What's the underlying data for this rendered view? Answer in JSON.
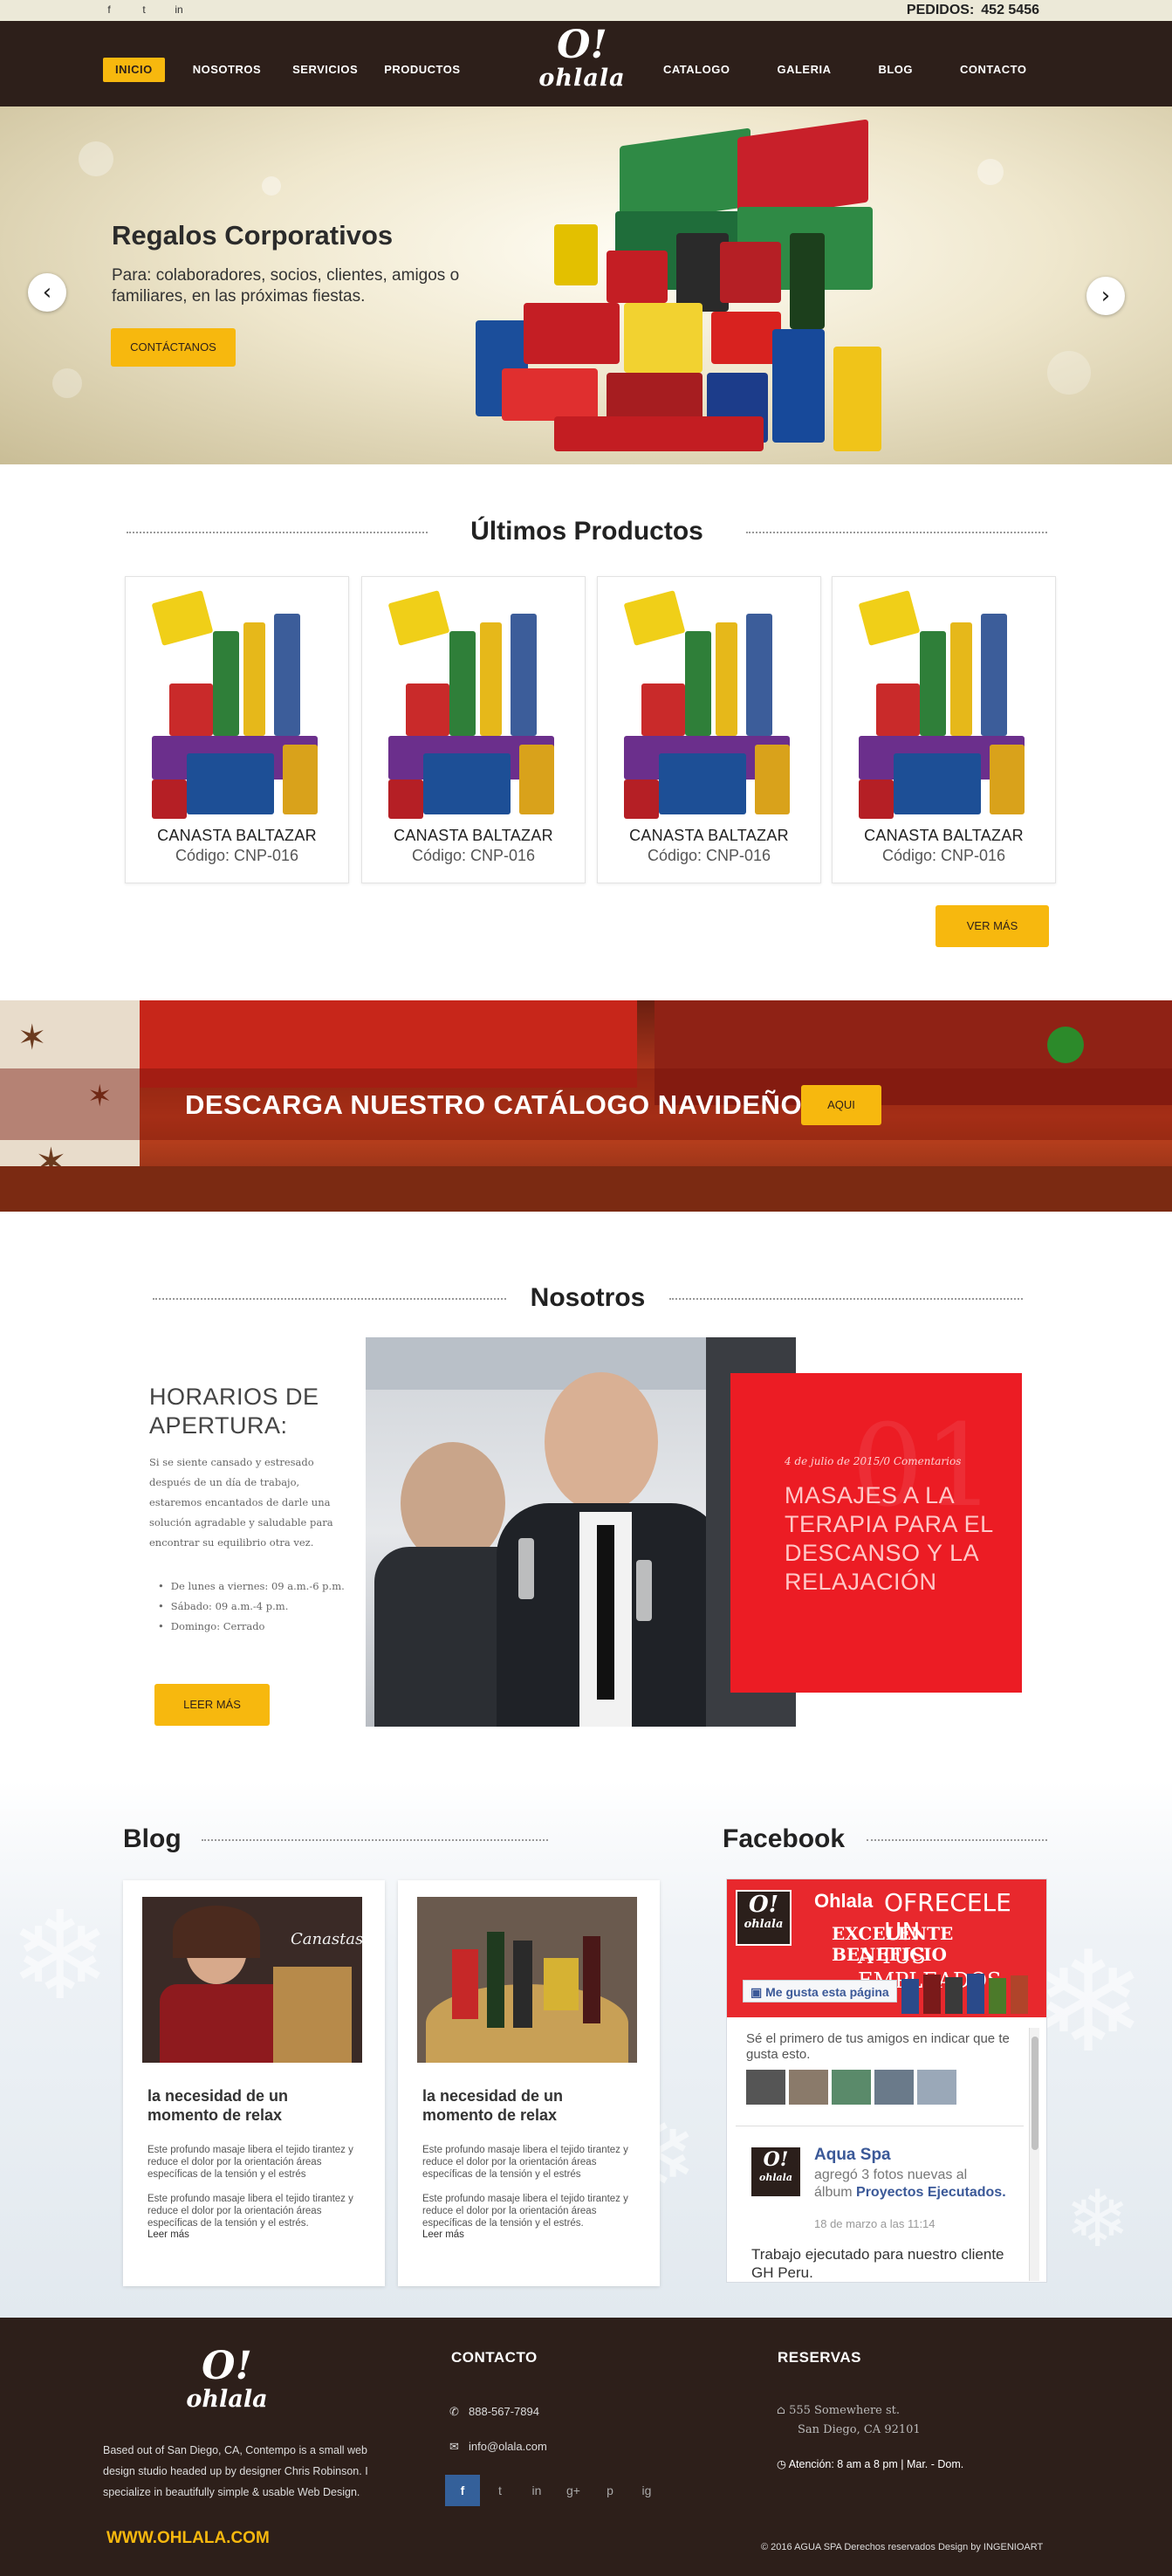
{
  "topbar": {
    "social": [
      "f",
      "t",
      "in"
    ],
    "pedidos_label": "PEDIDOS:",
    "pedidos_phone": "452 5456"
  },
  "nav": {
    "left": [
      "INICIO",
      "NOSOTROS",
      "SERVICIOS",
      "PRODUCTOS"
    ],
    "right": [
      "CATALOGO",
      "GALERIA",
      "BLOG",
      "CONTACTO"
    ],
    "logo_mark": "O!",
    "logo_word": "ohlala"
  },
  "hero": {
    "title": "Regalos Corporativos",
    "text": "Para: colaboradores, socios, clientes, amigos o familiares, en las próximas fiestas.",
    "button": "CONTÁCTANOS",
    "prev": "‹",
    "next": "›"
  },
  "products": {
    "title": "Últimos Productos",
    "items": [
      {
        "name": "CANASTA BALTAZAR",
        "code": "Código: CNP-016"
      },
      {
        "name": "CANASTA BALTAZAR",
        "code": "Código: CNP-016"
      },
      {
        "name": "CANASTA BALTAZAR",
        "code": "Código: CNP-016"
      },
      {
        "name": "CANASTA BALTAZAR",
        "code": "Código: CNP-016"
      }
    ],
    "more_button": "VER MÁS"
  },
  "catalog_banner": {
    "text": "DESCARGA NUESTRO CATÁLOGO NAVIDEÑO",
    "button": "AQUI"
  },
  "nosotros": {
    "title": "Nosotros",
    "hours_title": "HORARIOS DE APERTURA:",
    "description": "Si se siente cansado y estresado después de un día de trabajo, estaremos encantados de darle una solución agradable y saludable para encontrar su equilibrio otra vez.",
    "hours": [
      "De lunes a viernes: 09 a.m.-6 p.m.",
      "Sábado: 09 a.m.-4 p.m.",
      "Domingo: Cerrado"
    ],
    "read_more": "LEER MÁS",
    "feature_number": "01",
    "feature_date": "4 de julio de 2015/0 Comentarios",
    "feature_title": "MASAJES A LA TERAPIA PARA EL DESCANSO Y LA RELAJACIÓN"
  },
  "blog": {
    "title": "Blog",
    "posts": [
      {
        "title": "la necesidad de un momento de relax",
        "p1": "Este profundo masaje libera el tejido tirantez y reduce el dolor por la orientación áreas específicas de la tensión y el estrés",
        "p2": "Este profundo masaje libera el tejido tirantez y reduce el dolor por la orientación áreas específicas de la tensión y el estrés.",
        "more": "Leer más",
        "image_caption": "Canastas"
      },
      {
        "title": "la necesidad de un momento de relax",
        "p1": "Este profundo masaje libera el tejido tirantez y reduce el dolor por la orientación áreas específicas de la tensión y el estrés",
        "p2": "Este profundo masaje libera el tejido tirantez y reduce el dolor por la orientación áreas específicas de la tensión y el estrés.",
        "more": "Leer más"
      }
    ]
  },
  "facebook": {
    "title": "Facebook",
    "page_name": "Ohlala",
    "cover_ad_line1": "OFRECELE UN",
    "cover_ad_line2": "EXCELENTE BENEFICIO",
    "cover_ad_line3": "A TUS EMPLEADOS",
    "like_button": "Me gusta esta página",
    "friends_text": "Sé el primero de tus amigos en indicar que te gusta esto.",
    "post_author": "Aqua Spa",
    "post_action": "agregó 3 fotos nuevas al álbum",
    "post_album": "Proyectos Ejecutados.",
    "post_date": "18 de marzo a las 11:14",
    "post_body": "Trabajo ejecutado para nuestro cliente GH Peru."
  },
  "footer": {
    "about": "Based out of San Diego, CA, Contempo is a small web design studio headed up by designer Chris Robinson. I specialize in beautifully simple & usable Web Design.",
    "website": "WWW.OHLALA.COM",
    "contact_title": "CONTACTO",
    "phone": "888-567-7894",
    "email": "info@olala.com",
    "social": [
      "f",
      "t",
      "in",
      "g+",
      "p",
      "ig"
    ],
    "reservas_title": "RESERVAS",
    "address_line1": "555 Somewhere st.",
    "address_line2": "San Diego, CA 92101",
    "hours": "Atención: 8 am a 8 pm  |  Mar. - Dom.",
    "copyright": "© 2016  AGUA SPA  Derechos reservados Design by INGENIOART"
  },
  "colors": {
    "brown": "#2d1f1a",
    "yellow": "#f7b80e",
    "red": "#ec1c24",
    "facebook_blue": "#3b5998"
  }
}
